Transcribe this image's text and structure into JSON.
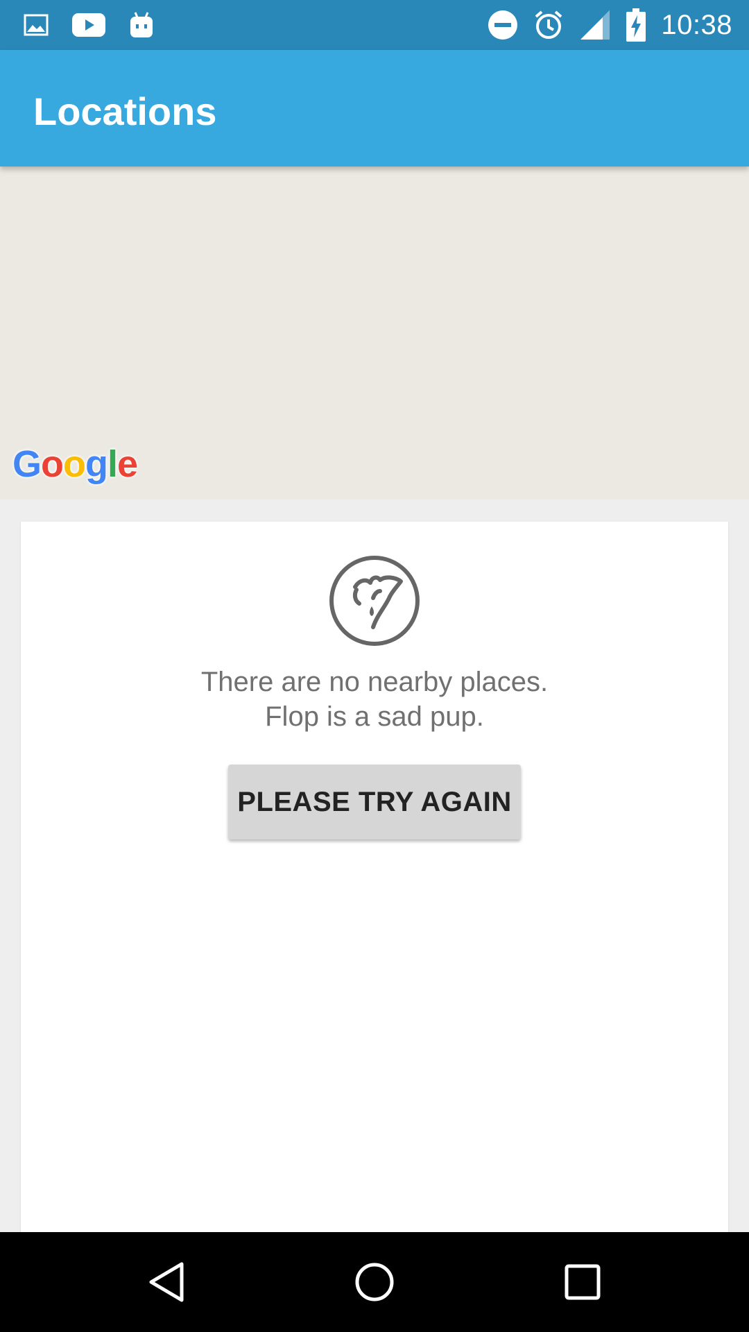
{
  "status_bar": {
    "time": "10:38",
    "left_icons": [
      "gallery-icon",
      "youtube-icon",
      "android-icon"
    ],
    "right_icons": [
      "do-not-disturb-icon",
      "alarm-icon",
      "signal-icon",
      "battery-charging-icon"
    ]
  },
  "app_bar": {
    "title": "Locations"
  },
  "map": {
    "logo_text": "Google"
  },
  "empty_state": {
    "line1": "There are no nearby places.",
    "line2": "Flop is a sad pup.",
    "icon": "sad-pup-icon"
  },
  "retry_button": {
    "label": "PLEASE TRY AGAIN"
  },
  "nav_bar": {
    "buttons": [
      "back-icon",
      "home-icon",
      "recents-icon"
    ]
  },
  "colors": {
    "status_bar": "#2a88b8",
    "app_bar": "#37a9df",
    "map_background": "#ebe9e2",
    "button": "#d6d6d6"
  }
}
